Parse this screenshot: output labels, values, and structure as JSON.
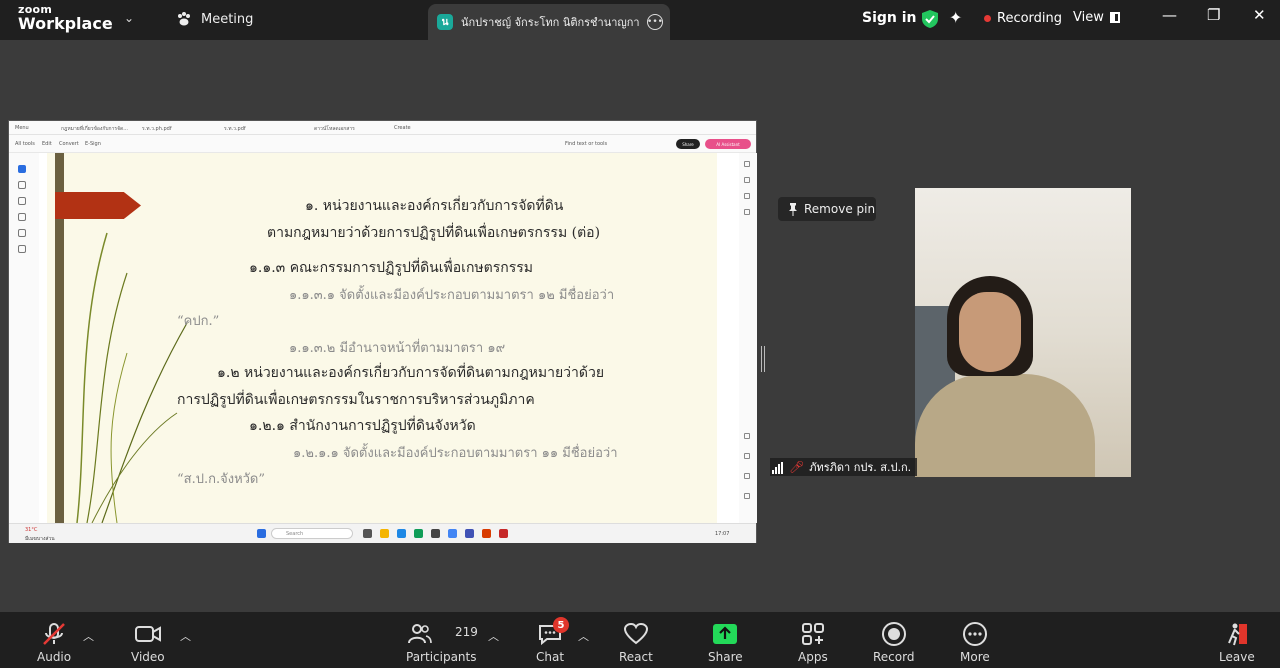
{
  "app": {
    "logo_line1": "zoom",
    "logo_line2": "Workplace"
  },
  "topbar": {
    "meeting_tab": "Meeting",
    "active_tab_badge": "น",
    "active_tab_title": "นักปราชญ์ จักระโทก นิติกรชำนาญการ",
    "sign_in": "Sign in",
    "recording": "Recording",
    "view": "View"
  },
  "share": {
    "toolbar_items": [
      "Menu",
      "กฎหมายที่เกี่ยวข้องกับการจัด...",
      "ร.ท.ว.ph.pdf",
      "ร.ท.ว.pdf",
      "ดาวน์โหลดเอกสาร",
      "Create"
    ],
    "tool_items": [
      "All tools",
      "Edit",
      "Convert",
      "E-Sign"
    ],
    "find_text": "Find text or tools",
    "share_btn": "Share",
    "ai_btn": "AI Assistant",
    "taskbar_weather": "31°C",
    "taskbar_weather_sub": "มีเมฆบางส่วน",
    "taskbar_search": "Search",
    "taskbar_clock": "17:07"
  },
  "slide": {
    "heading1": "๑. หน่วยงานและองค์กรเกี่ยวกับการจัดที่ดิน",
    "heading2": "ตามกฎหมายว่าด้วยการปฏิรูปที่ดินเพื่อเกษตรกรรม (ต่อ)",
    "l1": "๑.๑.๓ คณะกรรมการปฏิรูปที่ดินเพื่อเกษตรกรรม",
    "l2": "๑.๑.๓.๑ จัดตั้งและมีองค์ประกอบตามมาตรา ๑๒ มีชื่อย่อว่า",
    "l3": "“คปก.”",
    "l4": "๑.๑.๓.๒ มีอำนาจหน้าที่ตามมาตรา ๑๙",
    "l5": "๑.๒ หน่วยงานและองค์กรเกี่ยวกับการจัดที่ดินตามกฎหมายว่าด้วย",
    "l6": "การปฏิรูปที่ดินเพื่อเกษตรกรรมในราชการบริหารส่วนภูมิภาค",
    "l7": "๑.๒.๑ สำนักงานการปฏิรูปที่ดินจังหวัด",
    "l8": "๑.๒.๑.๑ จัดตั้งและมีองค์ประกอบตามมาตรา ๑๑ มีชื่อย่อว่า",
    "l9": "“ส.ป.ก.จังหวัด”"
  },
  "pin": {
    "label": "Remove pin"
  },
  "participant": {
    "name": "ภัทรภิดา กปร. ส.ป.ก."
  },
  "toolbar": {
    "audio": "Audio",
    "video": "Video",
    "participants": "Participants",
    "participants_count": "219",
    "chat": "Chat",
    "chat_badge": "5",
    "react": "React",
    "share": "Share",
    "apps": "Apps",
    "record": "Record",
    "more": "More",
    "leave": "Leave"
  },
  "colors": {
    "accent_green": "#23d959",
    "recording_red": "#e53935",
    "shield_green": "#22c55e",
    "leave_red": "#e0352b"
  }
}
